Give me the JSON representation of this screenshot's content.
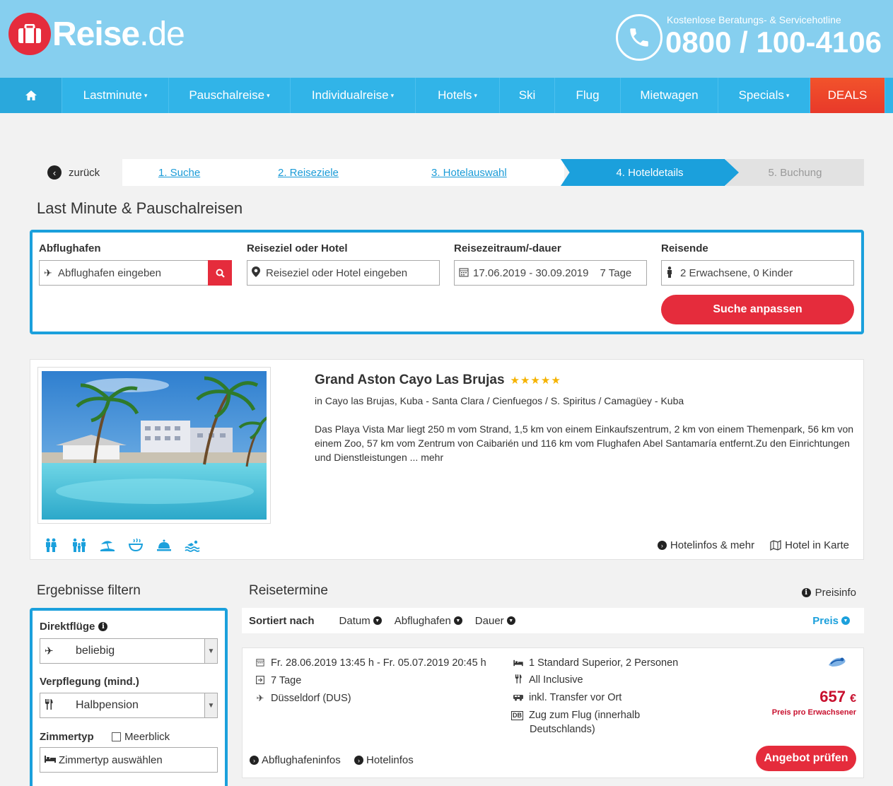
{
  "header": {
    "logo_main": "Reise",
    "logo_tld": ".de",
    "hotline_label": "Kostenlose Beratungs- & Servicehotline",
    "hotline_number": "0800 / 100-4106"
  },
  "nav": {
    "items": [
      {
        "label": "Lastminute",
        "caret": true
      },
      {
        "label": "Pauschalreise",
        "caret": true
      },
      {
        "label": "Individualreise",
        "caret": true
      },
      {
        "label": "Hotels",
        "caret": true
      },
      {
        "label": "Ski",
        "caret": false
      },
      {
        "label": "Flug",
        "caret": false
      },
      {
        "label": "Mietwagen",
        "caret": false
      },
      {
        "label": "Specials",
        "caret": true
      }
    ],
    "deals": "DEALS"
  },
  "steps": {
    "back": "zurück",
    "s1": "1. Suche",
    "s2": "2. Reiseziele",
    "s3": "3. Hotelauswahl",
    "s4": "4. Hoteldetails",
    "s5": "5. Buchung"
  },
  "page_title": "Last Minute & Pauschalreisen",
  "search": {
    "departure_label": "Abflughafen",
    "departure_placeholder": "Abflughafen eingeben",
    "destination_label": "Reiseziel oder Hotel",
    "destination_placeholder": "Reiseziel oder Hotel eingeben",
    "period_label": "Reisezeitraum/-dauer",
    "period_value": "17.06.2019 - 30.09.2019",
    "duration_value": "7 Tage",
    "travelers_label": "Reisende",
    "travelers_value": "2 Erwachsene, 0 Kinder",
    "submit": "Suche anpassen"
  },
  "hotel": {
    "name": "Grand Aston Cayo Las Brujas",
    "stars": "★★★★★",
    "star_count": 5,
    "location": "in Cayo las Brujas, Kuba - Santa Clara / Cienfuegos / S. Spiritus / Camagüey - Kuba",
    "description": "Das Playa Vista Mar liegt 250 m vom Strand, 1,5 km von einem Einkaufszentrum, 2 km von einem Themenpark, 56 km von einem Zoo, 57 km vom Zentrum von Caibarién und 116 km vom Flughafen Abel Santamaría entfernt.Zu den Einrichtungen und Dienstleistungen ... mehr",
    "link_info": "Hotelinfos & mehr",
    "link_map": "Hotel in Karte",
    "amenity_icons": [
      "couple-icon",
      "family-icon",
      "beach-icon",
      "spa-icon",
      "service-bell-icon",
      "swimming-icon"
    ],
    "accent_color": "#1ba0dc"
  },
  "filter": {
    "title": "Ergebnisse filtern",
    "direct_label": "Direktflüge",
    "direct_value": "beliebig",
    "board_label": "Verpflegung (mind.)",
    "board_value": "Halbpension",
    "room_label": "Zimmertyp",
    "seaview_label": "Meerblick",
    "room_placeholder": "Zimmertyp auswählen"
  },
  "results": {
    "title": "Reisetermine",
    "preisinfo": "Preisinfo",
    "sort_label": "Sortiert nach",
    "sort_date": "Datum",
    "sort_airport": "Abflughafen",
    "sort_duration": "Dauer",
    "sort_price": "Preis"
  },
  "offer": {
    "dates": "Fr. 28.06.2019 13:45 h - Fr. 05.07.2019 20:45 h",
    "duration": "7 Tage",
    "airport": "Düsseldorf (DUS)",
    "room": "1 Standard Superior, 2 Personen",
    "board": "All Inclusive",
    "transfer": "inkl. Transfer vor Ort",
    "train_line1": "Zug zum Flug (innerhalb",
    "train_line2": "Deutschlands)",
    "db_badge": "DB",
    "price": "657",
    "currency": "€",
    "price_note": "Preis pro Erwachsener",
    "cta": "Angebot prüfen",
    "link_airport": "Abflughafeninfos",
    "link_hotel": "Hotelinfos"
  },
  "colors": {
    "header_bg": "#86cfef",
    "nav_bg": "#31b4e8",
    "brand_red": "#e52c3c",
    "price_red": "#c8102e",
    "accent_blue": "#1ba0dc"
  }
}
